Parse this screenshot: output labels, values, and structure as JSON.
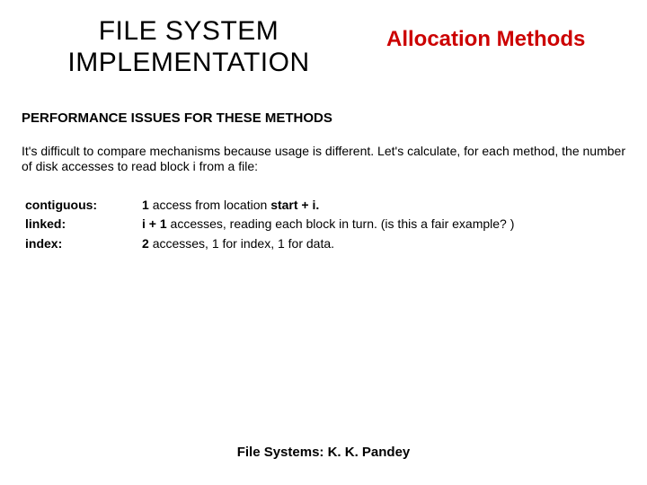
{
  "header": {
    "title_left": "FILE SYSTEM IMPLEMENTATION",
    "title_right": "Allocation Methods"
  },
  "subheading": "PERFORMANCE ISSUES FOR THESE METHODS",
  "body_text": "It's difficult to compare mechanisms because usage is different. Let's calculate, for each method, the number of disk accesses to read block i from a file:",
  "methods": {
    "rows": [
      {
        "label": "contiguous:",
        "desc_prefix_bold": "1 ",
        "desc_mid": "access from location ",
        "desc_suffix_bold": "start + i."
      },
      {
        "label": "linked:",
        "desc_prefix_bold": "i + 1 ",
        "desc_mid": "accesses, reading each block in turn. (is this a fair example? )",
        "desc_suffix_bold": ""
      },
      {
        "label": "index:",
        "desc_prefix_bold": "2 ",
        "desc_mid": "accesses, 1 for index, 1 for data.",
        "desc_suffix_bold": ""
      }
    ]
  },
  "footer": "File Systems: K. K. Pandey"
}
